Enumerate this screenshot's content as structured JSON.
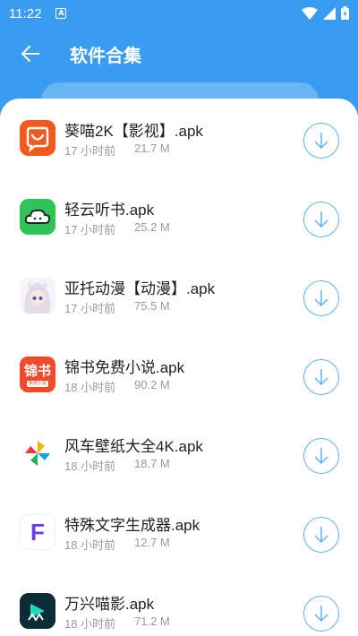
{
  "status_bar": {
    "time": "11:22"
  },
  "header": {
    "title": "软件合集"
  },
  "apps": [
    {
      "name": "葵喵2K【影视】.apk",
      "time": "17 小时前",
      "size": "21.7 M",
      "icon": "kuimiao-app-icon"
    },
    {
      "name": "轻云听书.apk",
      "time": "17 小时前",
      "size": "25.2 M",
      "icon": "qingyun-app-icon"
    },
    {
      "name": "亚托动漫【动漫】.apk",
      "time": "17 小时前",
      "size": "75.5 M",
      "icon": "yatuo-app-icon"
    },
    {
      "name": "锦书免费小说.apk",
      "time": "18 小时前",
      "size": "90.2 M",
      "icon": "jinshu-app-icon",
      "icon_text": "锦书",
      "icon_subtext": "免费小说"
    },
    {
      "name": "风车壁纸大全4K.apk",
      "time": "18 小时前",
      "size": "18.7 M",
      "icon": "pinwheel-app-icon"
    },
    {
      "name": "特殊文字生成器.apk",
      "time": "18 小时前",
      "size": "12.7 M",
      "icon": "font-f-app-icon",
      "icon_text": "F"
    },
    {
      "name": "万兴喵影.apk",
      "time": "18 小时前",
      "size": "71.2 M",
      "icon": "wondershare-app-icon"
    }
  ],
  "colors": {
    "header_bg": "#3a9cf0",
    "download_accent": "#5ab6ef"
  }
}
